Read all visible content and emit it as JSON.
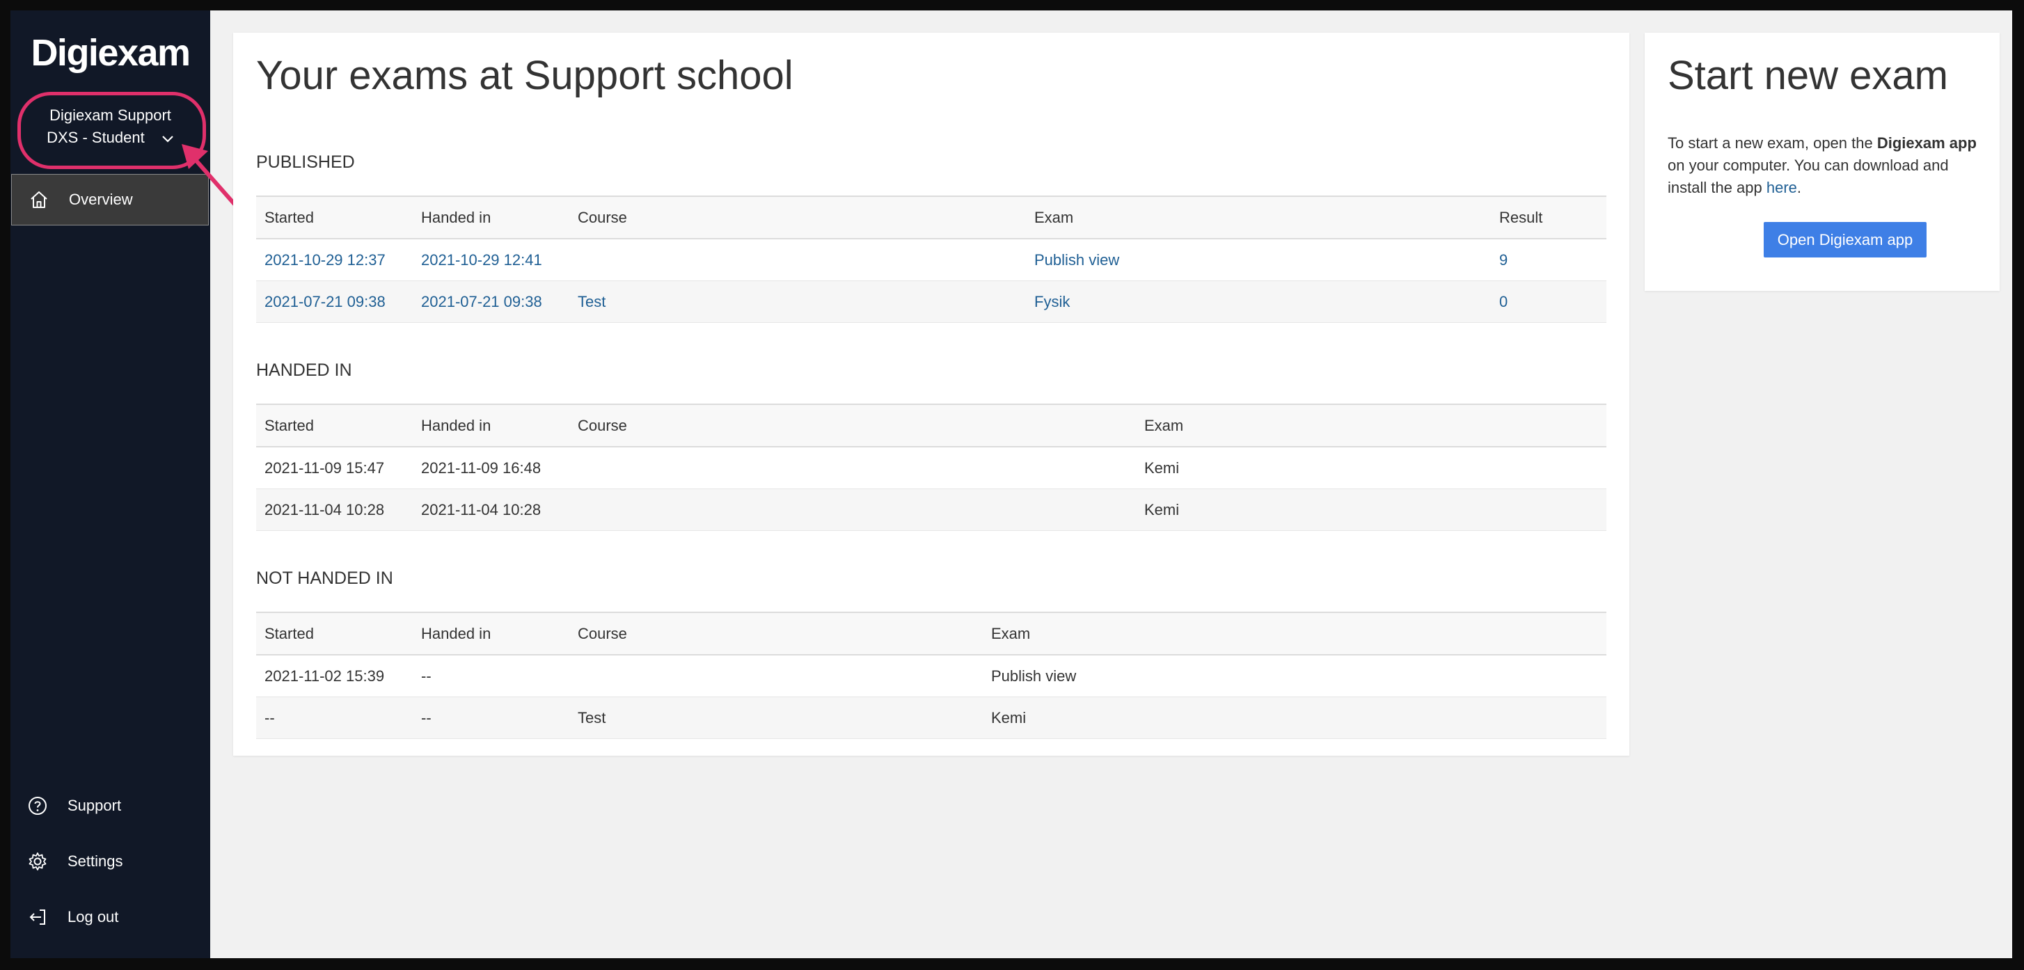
{
  "sidebar": {
    "logo": "Digiexam",
    "org": {
      "line1": "Digiexam Support",
      "line2": "DXS - Student"
    },
    "overview_label": "Overview",
    "bottom": {
      "support": "Support",
      "settings": "Settings",
      "logout": "Log out"
    }
  },
  "main": {
    "title": "Your exams at Support school",
    "published": {
      "heading": "PUBLISHED",
      "headers": [
        "Started",
        "Handed in",
        "Course",
        "Exam",
        "Result"
      ],
      "rows": [
        [
          "2021-10-29 12:37",
          "2021-10-29 12:41",
          "",
          "Publish view",
          "9"
        ],
        [
          "2021-07-21 09:38",
          "2021-07-21 09:38",
          "Test",
          "Fysik",
          "0"
        ]
      ]
    },
    "handed_in": {
      "heading": "HANDED IN",
      "headers": [
        "Started",
        "Handed in",
        "Course",
        "Exam"
      ],
      "rows": [
        [
          "2021-11-09 15:47",
          "2021-11-09 16:48",
          "",
          "Kemi"
        ],
        [
          "2021-11-04 10:28",
          "2021-11-04 10:28",
          "",
          "Kemi"
        ]
      ]
    },
    "not_handed_in": {
      "heading": "NOT HANDED IN",
      "headers": [
        "Started",
        "Handed in",
        "Course",
        "Exam"
      ],
      "rows": [
        [
          "2021-11-02 15:39",
          "--",
          "",
          "Publish view"
        ],
        [
          "--",
          "--",
          "Test",
          "Kemi"
        ]
      ]
    }
  },
  "start_card": {
    "title": "Start new exam",
    "text_1": "To start a new exam, open the ",
    "text_bold": "Digiexam app",
    "text_2": " on your computer. You can download and install the app ",
    "link": "here",
    "text_3": ".",
    "button": "Open Digiexam app"
  },
  "colors": {
    "sidebar": "#111827",
    "accent": "#3e7fe6",
    "link": "#1f5f94",
    "annotation": "#e0306b"
  }
}
